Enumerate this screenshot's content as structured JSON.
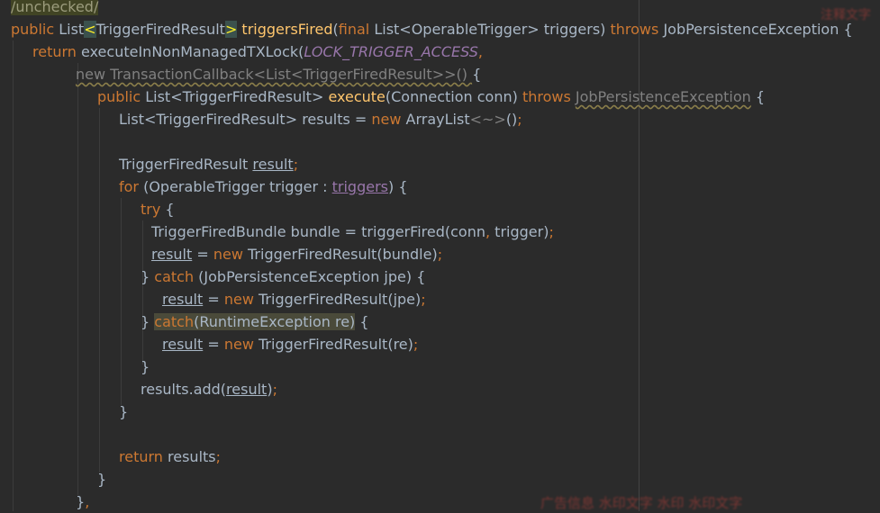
{
  "editor": {
    "lines": [
      {
        "segments": [
          [
            "anno",
            "/unchecked/"
          ]
        ]
      },
      {
        "segments": [
          [
            "kw",
            "public "
          ],
          [
            "",
            "List"
          ],
          [
            "gen-hl",
            "<"
          ],
          [
            "",
            "TriggerFiredResult"
          ],
          [
            "gen-hl",
            ">"
          ],
          [
            "fn",
            " triggersFired"
          ],
          [
            "",
            "("
          ],
          [
            "kw",
            "final "
          ],
          [
            "",
            "List<OperableTrigger> triggers) "
          ],
          [
            "kw",
            "throws "
          ],
          [
            "",
            "JobPersistenceException {"
          ]
        ]
      },
      {
        "segments": [
          [
            "kw",
            "return "
          ],
          [
            "",
            "executeInNonManagedTXLock("
          ],
          [
            "const",
            "LOCK_TRIGGER_ACCESS"
          ],
          [
            "punc",
            ","
          ]
        ]
      },
      {
        "segments": [
          [
            "dim wavy",
            "new TransactionCallback<List<TriggerFiredResult>>() "
          ],
          [
            "",
            "{"
          ]
        ]
      },
      {
        "segments": [
          [
            "kw",
            "public "
          ],
          [
            "",
            "List<TriggerFiredResult> "
          ],
          [
            "fn",
            "execute"
          ],
          [
            "",
            "(Connection conn) "
          ],
          [
            "kw",
            "throws "
          ],
          [
            "dim wavy",
            "JobPersistenceException"
          ],
          [
            "",
            " {"
          ]
        ]
      },
      {
        "segments": [
          [
            "",
            "List<TriggerFiredResult> results = "
          ],
          [
            "kw",
            "new "
          ],
          [
            "",
            "ArrayList"
          ],
          [
            "dim",
            "<~>"
          ],
          [
            "",
            "()"
          ],
          [
            "punc",
            ";"
          ]
        ]
      },
      {
        "segments": []
      },
      {
        "segments": [
          [
            "",
            "TriggerFiredResult "
          ],
          [
            "ul",
            "result"
          ],
          [
            "punc",
            ";"
          ]
        ]
      },
      {
        "segments": [
          [
            "kw",
            "for "
          ],
          [
            "",
            "(OperableTrigger trigger : "
          ],
          [
            "field ul",
            "triggers"
          ],
          [
            "",
            ") {"
          ]
        ]
      },
      {
        "segments": [
          [
            "kw",
            "try "
          ],
          [
            "",
            "{"
          ]
        ]
      },
      {
        "segments": [
          [
            "",
            "TriggerFiredBundle bundle = triggerFired(conn"
          ],
          [
            "punc",
            ", "
          ],
          [
            "",
            "trigger)"
          ],
          [
            "punc",
            ";"
          ]
        ]
      },
      {
        "segments": [
          [
            "ul",
            "result"
          ],
          [
            "",
            " = "
          ],
          [
            "kw",
            "new "
          ],
          [
            "",
            "TriggerFiredResult(bundle)"
          ],
          [
            "punc",
            ";"
          ]
        ]
      },
      {
        "segments": [
          [
            "",
            "} "
          ],
          [
            "kw",
            "catch "
          ],
          [
            "",
            "(JobPersistenceException jpe) {"
          ]
        ]
      },
      {
        "segments": [
          [
            "ul",
            "result"
          ],
          [
            "",
            " = "
          ],
          [
            "kw",
            "new "
          ],
          [
            "",
            "TriggerFiredResult(jpe)"
          ],
          [
            "punc",
            ";"
          ]
        ]
      },
      {
        "segments": [
          [
            "",
            "} "
          ],
          [
            "kw hl-block",
            "catch"
          ],
          [
            "hl-block",
            "(RuntimeException re)"
          ],
          [
            "",
            " {"
          ]
        ]
      },
      {
        "segments": [
          [
            "ul",
            "result"
          ],
          [
            "",
            " = "
          ],
          [
            "kw",
            "new "
          ],
          [
            "",
            "TriggerFiredResult(re)"
          ],
          [
            "punc",
            ";"
          ]
        ]
      },
      {
        "segments": [
          [
            "",
            "}"
          ]
        ]
      },
      {
        "segments": [
          [
            "",
            "results.add("
          ],
          [
            "ul",
            "result"
          ],
          [
            "",
            ")"
          ],
          [
            "punc",
            ";"
          ]
        ]
      },
      {
        "segments": [
          [
            "",
            "}"
          ]
        ]
      },
      {
        "segments": []
      },
      {
        "segments": [
          [
            "kw",
            "return "
          ],
          [
            "",
            "results"
          ],
          [
            "punc",
            ";"
          ]
        ]
      },
      {
        "segments": [
          [
            "",
            "}"
          ]
        ]
      },
      {
        "segments": [
          [
            "",
            "}"
          ],
          [
            "punc",
            ","
          ]
        ]
      }
    ]
  },
  "overlay": {
    "top_right_blur": "注释文字",
    "bottom_right_blur": "广告信息 水印文字 水印 水印文字"
  }
}
